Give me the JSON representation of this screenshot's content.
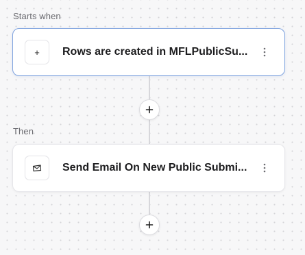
{
  "trigger_section": {
    "label": "Starts when",
    "card": {
      "title": "Rows are created in MFLPublicSu...",
      "icon": "plus-icon",
      "icon_glyph": "+",
      "menu_icon": "kebab-menu-icon",
      "selected": true
    }
  },
  "action_section": {
    "label": "Then",
    "card": {
      "title": "Send Email On New Public Submi...",
      "icon": "email-icon",
      "menu_icon": "kebab-menu-icon",
      "selected": false
    }
  },
  "add_step_buttons": [
    {
      "icon": "plus-icon"
    },
    {
      "icon": "plus-icon"
    }
  ],
  "colors": {
    "canvas_background": "#f7f7f8",
    "canvas_dot": "#d4d4d8",
    "selected_border": "#7fa3df",
    "card_border": "#e6e6ea",
    "connector": "#d7d7db",
    "section_label": "#6b6b70"
  }
}
